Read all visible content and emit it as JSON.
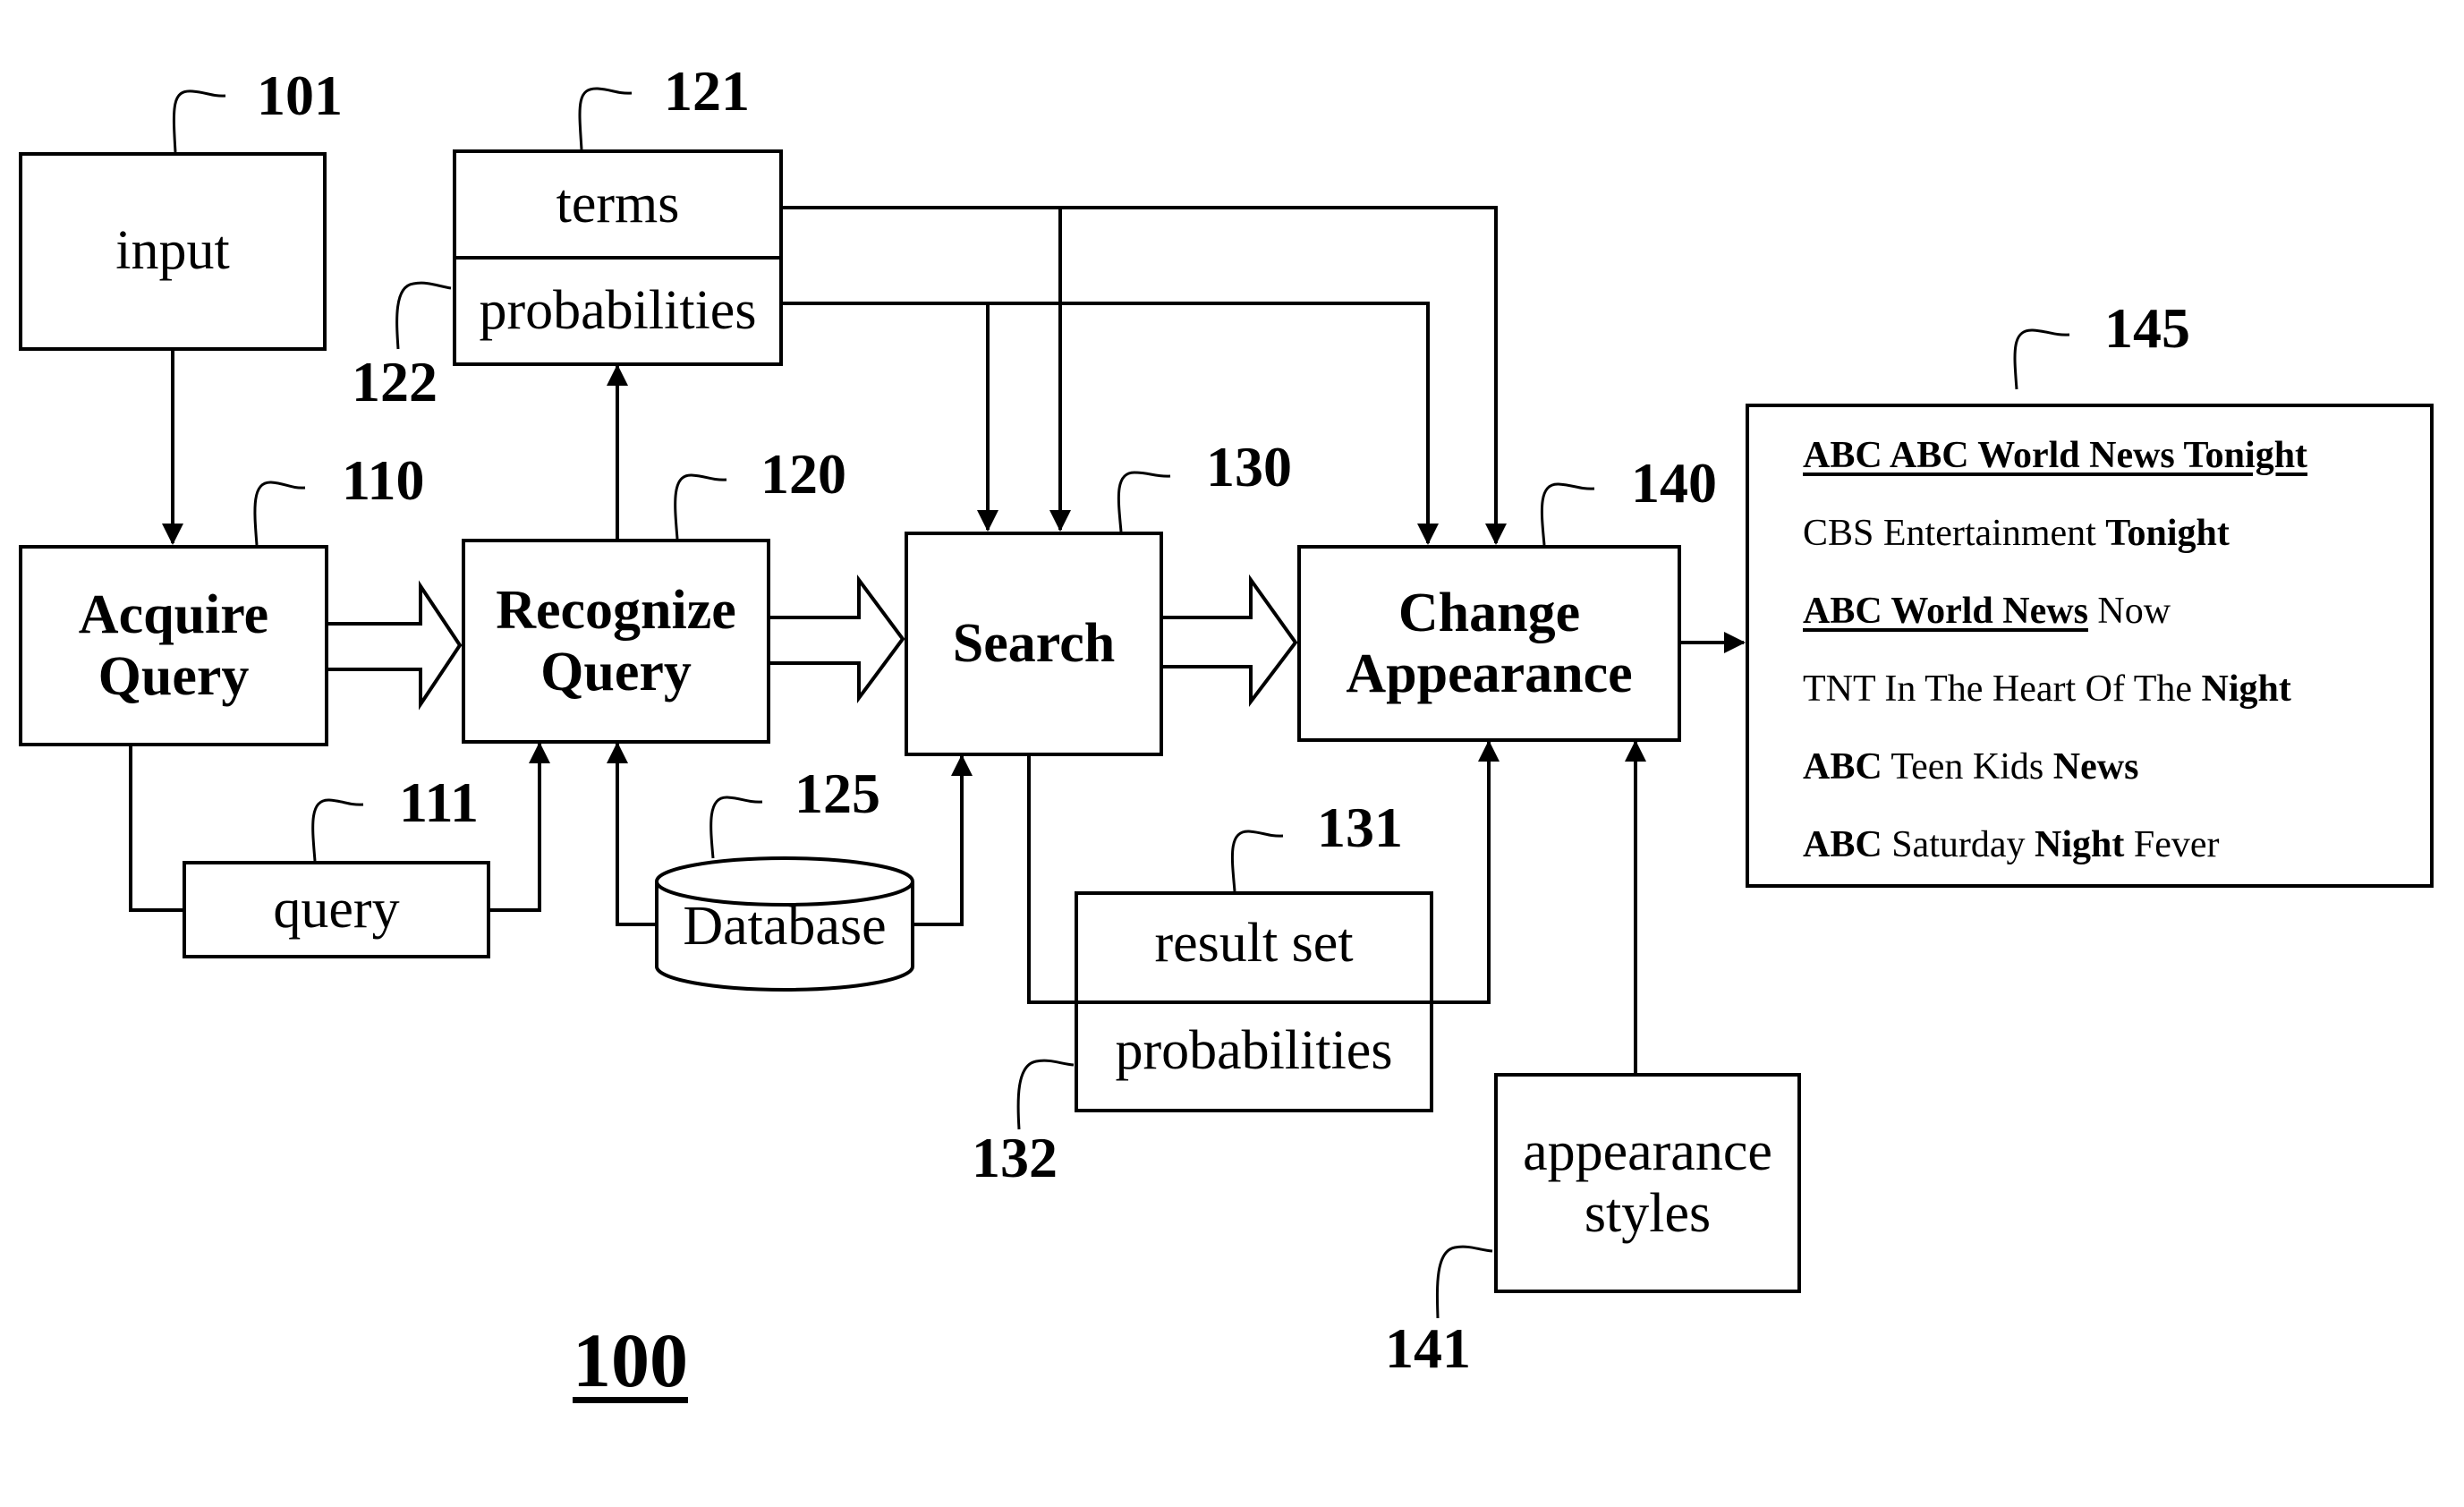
{
  "figure": {
    "label": "100"
  },
  "nodes": {
    "input": {
      "text": "input",
      "ref": "101"
    },
    "terms": {
      "text": "terms",
      "ref": "121"
    },
    "probabilities_top": {
      "text": "probabilities",
      "ref": "122"
    },
    "acquire": {
      "line1": "Acquire",
      "line2": "Query",
      "ref": "110"
    },
    "recognize": {
      "line1": "Recognize",
      "line2": "Query",
      "ref": "120"
    },
    "search": {
      "text": "Search",
      "ref": "130"
    },
    "change": {
      "line1": "Change",
      "line2": "Appearance",
      "ref": "140"
    },
    "query": {
      "text": "query",
      "ref": "111"
    },
    "database": {
      "text": "Database",
      "ref": "125"
    },
    "result_set": {
      "text": "result set",
      "ref": "131"
    },
    "probabilities_bottom": {
      "text": "probabilities",
      "ref": "132"
    },
    "styles": {
      "line1": "appearance",
      "line2": "styles",
      "ref": "141"
    },
    "results": {
      "ref": "145"
    }
  },
  "results": [
    {
      "parts": [
        {
          "t": "ABC ABC World News Tonight",
          "bold": true,
          "underline": true
        }
      ]
    },
    {
      "parts": [
        {
          "t": "CBS Entertainment ",
          "bold": false
        },
        {
          "t": "Tonight",
          "bold": true
        }
      ]
    },
    {
      "parts": [
        {
          "t": "ABC World News",
          "bold": true,
          "underline": true
        },
        {
          "t": " Now",
          "bold": false
        }
      ]
    },
    {
      "parts": [
        {
          "t": "TNT In The Heart Of The ",
          "bold": false
        },
        {
          "t": "Night",
          "bold": true
        }
      ]
    },
    {
      "parts": [
        {
          "t": "ABC",
          "bold": true
        },
        {
          "t": " Teen Kids ",
          "bold": false
        },
        {
          "t": "News",
          "bold": true
        }
      ]
    },
    {
      "parts": [
        {
          "t": "ABC",
          "bold": true
        },
        {
          "t": " Saturday ",
          "bold": false
        },
        {
          "t": "Night",
          "bold": true
        },
        {
          "t": " Fever",
          "bold": false
        }
      ]
    }
  ]
}
